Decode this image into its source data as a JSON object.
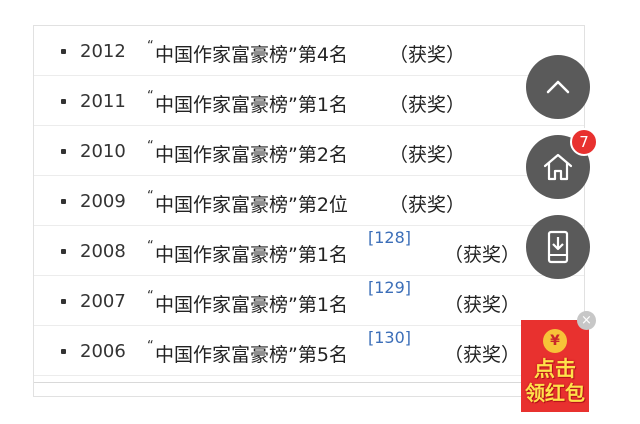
{
  "entries": [
    {
      "year": "2012",
      "title": "中国作家富豪榜”第4名",
      "ref": "",
      "award": "（获奖）"
    },
    {
      "year": "2011",
      "title": "中国作家富豪榜”第1名",
      "ref": "",
      "award": "（获奖）"
    },
    {
      "year": "2010",
      "title": "中国作家富豪榜”第2名",
      "ref": "",
      "award": "（获奖）"
    },
    {
      "year": "2009",
      "title": "中国作家富豪榜”第2位",
      "ref": "",
      "award": "（获奖）"
    },
    {
      "year": "2008",
      "title": "中国作家富豪榜”第1名",
      "ref": "[128]",
      "award": "（获奖）"
    },
    {
      "year": "2007",
      "title": "中国作家富豪榜”第1名",
      "ref": "[129]",
      "award": "（获奖）"
    },
    {
      "year": "2006",
      "title": "中国作家富豪榜”第5名",
      "ref": "[130]",
      "award": "（获奖）"
    }
  ],
  "open_quote": "“",
  "floating": {
    "up_icon": "chevron-up-icon",
    "home_icon": "home-icon",
    "home_badge": "7",
    "download_icon": "phone-download-icon"
  },
  "redpack": {
    "coin": "¥",
    "line1": "点击",
    "line2": "领红包",
    "close": "×"
  },
  "colors": {
    "button_bg": "#5a5a5a",
    "badge": "#e8312f",
    "ref_link": "#3b6eb8",
    "redpack_bg": "#e8312f",
    "redpack_text": "#ffe14a"
  }
}
